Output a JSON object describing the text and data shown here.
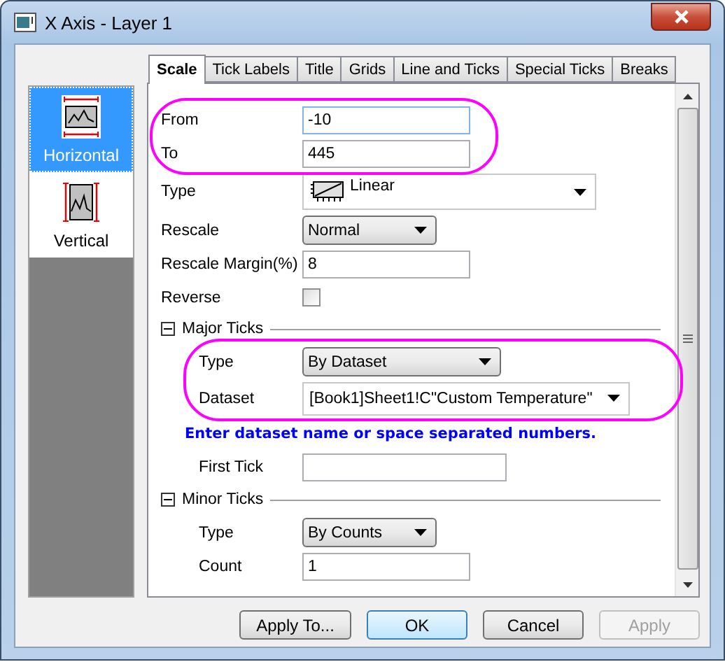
{
  "window": {
    "title": "X Axis - Layer 1"
  },
  "sidebar": {
    "items": [
      {
        "label": "Horizontal",
        "kind": "horizontal",
        "selected": true
      },
      {
        "label": "Vertical",
        "kind": "vertical",
        "selected": false
      }
    ]
  },
  "tabs": [
    {
      "label": "Scale",
      "selected": true
    },
    {
      "label": "Tick Labels",
      "selected": false
    },
    {
      "label": "Title",
      "selected": false
    },
    {
      "label": "Grids",
      "selected": false
    },
    {
      "label": "Line and Ticks",
      "selected": false
    },
    {
      "label": "Special Ticks",
      "selected": false
    },
    {
      "label": "Breaks",
      "selected": false
    }
  ],
  "form": [
    {
      "kind": "group",
      "highlighted": true,
      "children": [
        {
          "kind": "text",
          "label": "From",
          "value": "-10",
          "focused": true
        },
        {
          "kind": "text",
          "label": "To",
          "value": "445",
          "focused": false
        }
      ]
    },
    {
      "kind": "icon-combo",
      "label": "Type",
      "value": "Linear"
    },
    {
      "kind": "dropdown",
      "label": "Rescale",
      "value": "Normal"
    },
    {
      "kind": "text",
      "label": "Rescale Margin(%)",
      "value": "8",
      "focused": false
    },
    {
      "kind": "checkbox",
      "label": "Reverse",
      "checked": false
    },
    {
      "kind": "section",
      "label": "Major Ticks",
      "expanded": true,
      "children": [
        {
          "kind": "group",
          "highlighted": true,
          "children": [
            {
              "kind": "dropdown",
              "label": "Type",
              "value": "By Dataset"
            },
            {
              "kind": "combo",
              "label": "Dataset",
              "value": "[Book1]Sheet1!C\"Custom Temperature\""
            }
          ]
        },
        {
          "kind": "hint",
          "text": "Enter dataset name or space separated numbers."
        },
        {
          "kind": "text",
          "label": "First Tick",
          "focused": false
        }
      ]
    },
    {
      "kind": "section",
      "label": "Minor Ticks",
      "expanded": true,
      "children": [
        {
          "kind": "dropdown",
          "label": "Type",
          "value": "By Counts"
        },
        {
          "kind": "text",
          "label": "Count",
          "value": "1",
          "focused": false
        }
      ]
    }
  ],
  "buttons": [
    {
      "label": "Apply To...",
      "default": false,
      "disabled": false
    },
    {
      "label": "OK",
      "default": true,
      "disabled": false
    },
    {
      "label": "Cancel",
      "default": false,
      "disabled": false
    },
    {
      "label": "Apply",
      "default": false,
      "disabled": true
    }
  ]
}
